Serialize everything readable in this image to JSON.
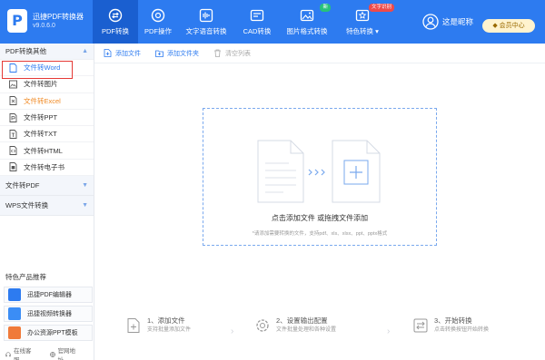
{
  "app": {
    "name": "迅捷PDF转换器",
    "version": "v9.0.6.0"
  },
  "nav": [
    {
      "label": "PDF转换",
      "icon": "sync-icon",
      "active": true
    },
    {
      "label": "PDF操作",
      "icon": "pdf-gear-icon"
    },
    {
      "label": "文字语音转换",
      "icon": "audio-wave-icon"
    },
    {
      "label": "CAD转换",
      "icon": "cad-icon"
    },
    {
      "label": "图片格式转换",
      "icon": "image-icon",
      "badge": "新"
    },
    {
      "label": "特色转换",
      "icon": "feature-icon",
      "badge": "文字识别"
    }
  ],
  "account": {
    "login_label": "这是昵称",
    "member_label": "会员中心"
  },
  "sidebar": {
    "section_title": "PDF转换其他",
    "items": [
      {
        "label": "文件转Word"
      },
      {
        "label": "文件转图片"
      },
      {
        "label": "文件转Excel"
      },
      {
        "label": "文件转PPT"
      },
      {
        "label": "文件转TXT"
      },
      {
        "label": "文件转HTML"
      },
      {
        "label": "文件转电子书"
      }
    ],
    "groups": [
      {
        "label": "文件转PDF"
      },
      {
        "label": "WPS文件转换"
      }
    ],
    "recommend_title": "特色产品推荐",
    "recommend": [
      {
        "label": "迅捷PDF编辑器"
      },
      {
        "label": "迅捷视频转换器"
      },
      {
        "label": "办公资源PPT模板"
      }
    ],
    "links": {
      "service": "在线客服",
      "website": "官网地址"
    }
  },
  "toolbar": {
    "add_file": "添加文件",
    "add_folder": "添加文件夹",
    "clear_list": "清空列表"
  },
  "dropzone": {
    "text": "点击添加文件 或拖拽文件添加",
    "hint": "*请添加需要转换的文件，支持pdf、xls、xlsx、ppt、pptx格式"
  },
  "steps": [
    {
      "title": "1、添加文件",
      "desc": "支持批量添加文件"
    },
    {
      "title": "2、设置输出配置",
      "desc": "文件批量处理和各种设置"
    },
    {
      "title": "3、开始转换",
      "desc": "点击转换按钮开始转换"
    }
  ],
  "colors": {
    "primary": "#2d7bf0",
    "highlight_border": "#e53935",
    "excel_item": "#f08a24"
  }
}
